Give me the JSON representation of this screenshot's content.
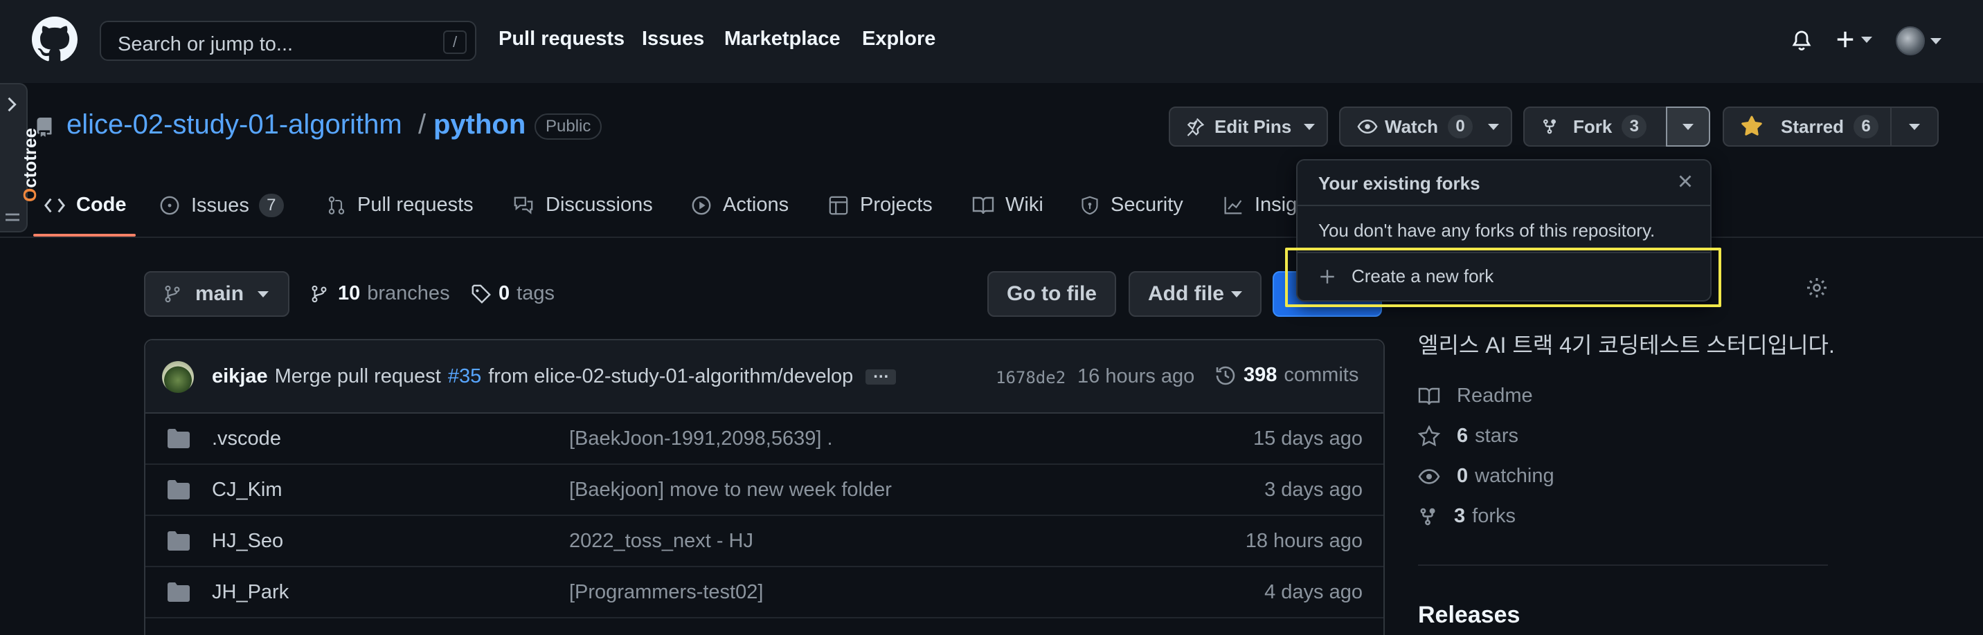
{
  "header": {
    "search_placeholder": "Search or jump to...",
    "search_shortcut": "/",
    "nav": [
      "Pull requests",
      "Issues",
      "Marketplace",
      "Explore"
    ]
  },
  "octotree": {
    "label_o": "O",
    "label_rest": "ctotree"
  },
  "repo": {
    "owner": "elice-02-study-01-algorithm",
    "separator": "/",
    "name": "python",
    "visibility": "Public"
  },
  "actions": {
    "edit_pins": "Edit Pins",
    "watch_label": "Watch",
    "watch_count": "0",
    "fork_label": "Fork",
    "fork_count": "3",
    "starred_label": "Starred",
    "starred_count": "6"
  },
  "tabs": [
    {
      "label": "Code"
    },
    {
      "label": "Issues",
      "count": "7"
    },
    {
      "label": "Pull requests"
    },
    {
      "label": "Discussions"
    },
    {
      "label": "Actions"
    },
    {
      "label": "Projects"
    },
    {
      "label": "Wiki"
    },
    {
      "label": "Security"
    },
    {
      "label": "Insig"
    }
  ],
  "branch": {
    "current": "main",
    "branches_count": "10",
    "branches_label": "branches",
    "tags_count": "0",
    "tags_label": "tags",
    "go_to_file": "Go to file",
    "add_file": "Add file"
  },
  "commit": {
    "author": "eikjae",
    "message_prefix": "Merge pull request",
    "pr_link": "#35",
    "message_suffix": "from elice-02-study-01-algorithm/develop",
    "ellipsis": "…",
    "sha": "1678de2",
    "time": "16 hours ago",
    "commits_count": "398",
    "commits_label": "commits"
  },
  "files": [
    {
      "name": ".vscode",
      "message": "[BaekJoon-1991,2098,5639] .",
      "age": "15 days ago"
    },
    {
      "name": "CJ_Kim",
      "message": "[Baekjoon] move to new week folder",
      "age": "3 days ago"
    },
    {
      "name": "HJ_Seo",
      "message": "2022_toss_next - HJ",
      "age": "18 hours ago"
    },
    {
      "name": "JH_Park",
      "message": "[Programmers-test02]",
      "age": "4 days ago"
    }
  ],
  "sidebar": {
    "description": "엘리스 AI 트랙 4기 코딩테스트 스터디입니다.",
    "readme": "Readme",
    "stars_count": "6",
    "stars_label": "stars",
    "watching_count": "0",
    "watching_label": "watching",
    "forks_count": "3",
    "forks_label": "forks",
    "releases": "Releases"
  },
  "fork_popover": {
    "title": "Your existing forks",
    "empty_text": "You don't have any forks of this repository.",
    "create_label": "Create a new fork"
  },
  "colors": {
    "accent_link": "#58a6ff",
    "tab_underline": "#f78166",
    "highlight": "#f1e84a",
    "star": "#e3b341"
  }
}
